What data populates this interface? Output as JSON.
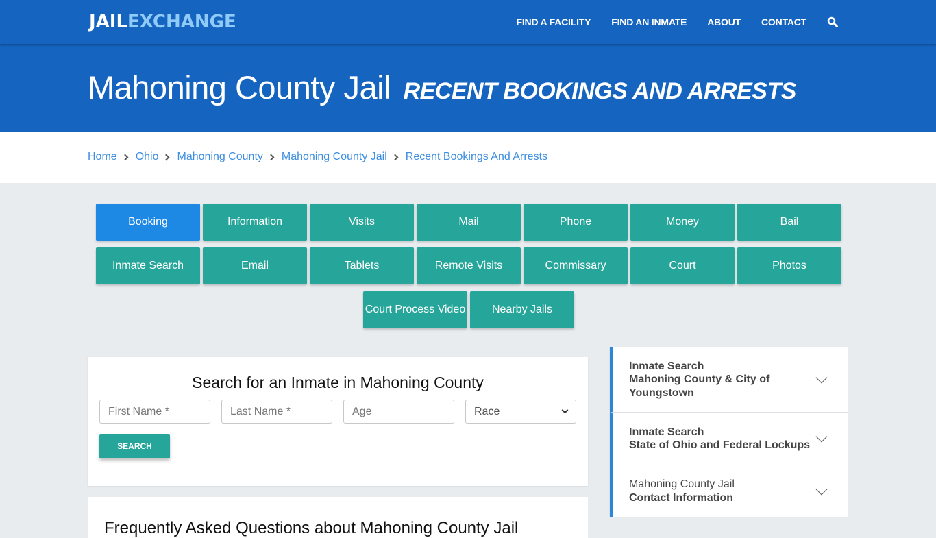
{
  "nav": {
    "logo_part1": "JAIL",
    "logo_part2": "EXCHANGE",
    "links": [
      "FIND A FACILITY",
      "FIND AN INMATE",
      "ABOUT",
      "CONTACT"
    ],
    "search_icon": "search-icon"
  },
  "hero": {
    "title": "Mahoning County Jail",
    "subtitle": "RECENT BOOKINGS AND ARRESTS"
  },
  "breadcrumb": [
    "Home",
    "Ohio",
    "Mahoning County",
    "Mahoning County Jail",
    "Recent Bookings And Arrests"
  ],
  "tiles": {
    "row1": [
      "Booking",
      "Information",
      "Visits",
      "Mail",
      "Phone",
      "Money",
      "Bail"
    ],
    "row2": [
      "Inmate Search",
      "Email",
      "Tablets",
      "Remote Visits",
      "Commissary",
      "Court",
      "Photos"
    ],
    "row3": [
      "Court Process Video",
      "Nearby Jails"
    ],
    "active": "Booking"
  },
  "search": {
    "title": "Search for an Inmate in Mahoning County",
    "first_name_placeholder": "First Name *",
    "last_name_placeholder": "Last Name *",
    "age_placeholder": "Age",
    "race_selected": "Race",
    "button": "SEARCH"
  },
  "faq": {
    "title": "Frequently Asked Questions about Mahoning County Jail"
  },
  "sidebar": {
    "items": [
      {
        "line1": "Inmate Search",
        "line2": "Mahoning County & City of",
        "line3": "Youngstown"
      },
      {
        "line1": "Inmate Search",
        "line2": "State of Ohio and Federal Lockups"
      },
      {
        "line1": "Mahoning County Jail",
        "line2": "Contact Information"
      }
    ]
  },
  "colors": {
    "brand_blue": "#1565c0",
    "logo_accent": "#90caf9",
    "teal": "#26a69a",
    "active_tile": "#1e88e5",
    "link": "#3d8ee0"
  }
}
